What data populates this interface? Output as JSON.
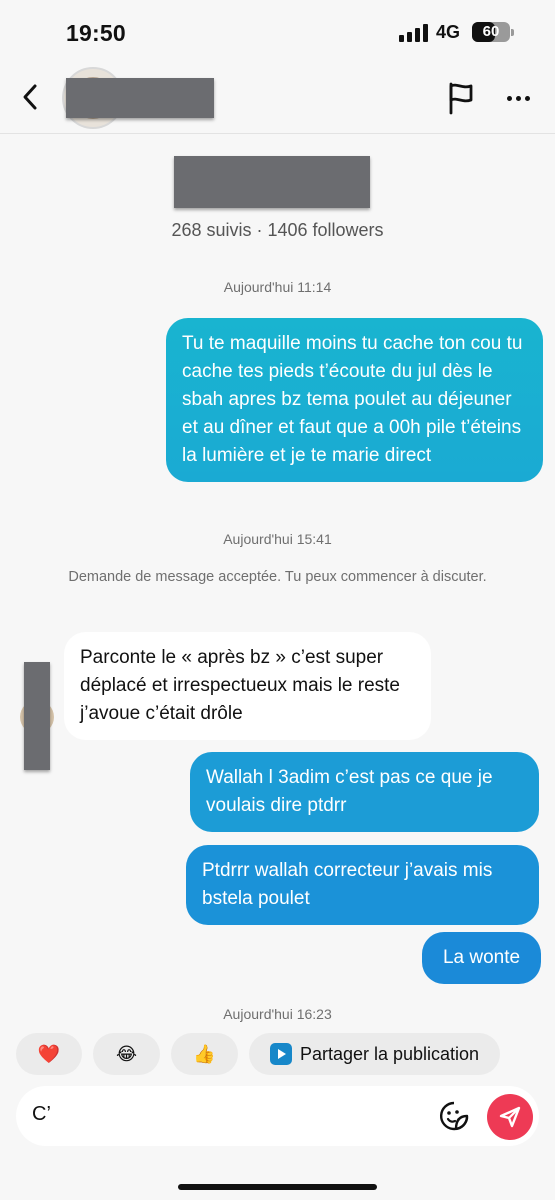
{
  "status_bar": {
    "time": "19:50",
    "network": "4G",
    "battery": "60",
    "battery_level": 0.6
  },
  "header": {
    "back_icon": "chevron-left-icon",
    "flag_icon": "flag-icon",
    "more_icon": "more-horizontal-icon"
  },
  "profile": {
    "stats": "268 suivis · 1406 followers"
  },
  "messages": {
    "ts1": "Aujourd'hui 11:14",
    "m1": "Tu te maquille moins tu cache ton cou tu cache tes pieds t’écoute du jul dès le sbah apres bz tema poulet au déjeuner et au dîner et faut que a 00h pile t’éteins la lumière et je te marie direct",
    "ts2": "Aujourd'hui 15:41",
    "system": "Demande de message acceptée. Tu peux commencer à discuter.",
    "m2": "Parconte le « après bz » c’est super déplacé et irrespectueux mais le reste j’avoue c’était drôle",
    "m3": "Wallah l 3adim c’est pas ce que je voulais dire ptdrr",
    "m4": "Ptdrrr wallah correcteur j’avais mis bstela poulet",
    "m5": "La wonte",
    "ts3": "Aujourd'hui 16:23"
  },
  "quick_reactions": {
    "heart": "❤️",
    "laugh": "😂",
    "thumbs": "👍",
    "share_label": "Partager la publication"
  },
  "composer": {
    "value": "C’",
    "sticker_icon": "sticker-icon",
    "send_icon": "send-icon"
  },
  "colors": {
    "outgoing_top": "#1ab1d1",
    "outgoing_bottom": "#1b8ad8",
    "send": "#ee3a55"
  }
}
